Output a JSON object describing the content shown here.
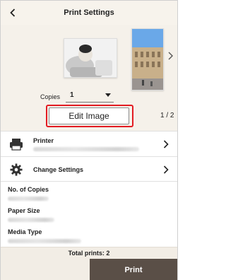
{
  "header": {
    "title": "Print Settings",
    "back_icon": "chevron-left-icon"
  },
  "preview": {
    "copies_label": "Copies",
    "copies_value": "1",
    "edit_button_label": "Edit Image",
    "page_indicator": "1 / 2",
    "highlight_color": "#e31c23"
  },
  "settings": {
    "printer_label": "Printer",
    "printer_icon": "printer-icon",
    "change_settings_label": "Change Settings",
    "change_settings_icon": "gear-icon"
  },
  "info": {
    "copies_label": "No. of Copies",
    "paper_size_label": "Paper Size",
    "media_type_label": "Media Type"
  },
  "footer": {
    "total_prints": "Total prints: 2",
    "print_button_label": "Print",
    "print_button_color": "#5a4f47"
  }
}
